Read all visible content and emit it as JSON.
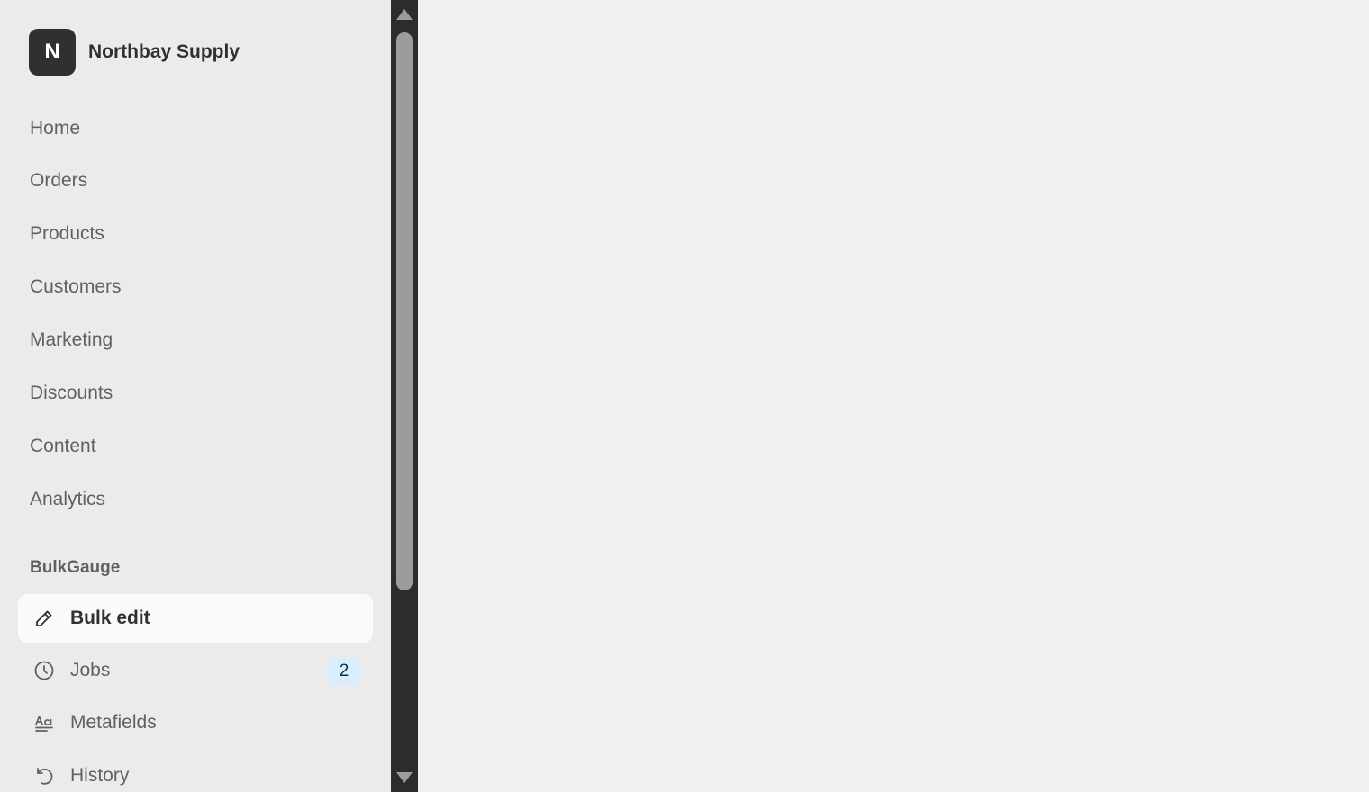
{
  "brand": {
    "initial": "N",
    "name": "Northbay Supply"
  },
  "nav": {
    "items": [
      {
        "label": "Home"
      },
      {
        "label": "Orders"
      },
      {
        "label": "Products"
      },
      {
        "label": "Customers"
      },
      {
        "label": "Marketing"
      },
      {
        "label": "Discounts"
      },
      {
        "label": "Content"
      },
      {
        "label": "Analytics"
      }
    ]
  },
  "app_section": {
    "title": "BulkGauge",
    "items": [
      {
        "label": "Bulk edit",
        "icon": "pencil-icon",
        "active": true
      },
      {
        "label": "Jobs",
        "icon": "clock-icon",
        "badge": "2"
      },
      {
        "label": "Metafields",
        "icon": "metafields-icon"
      },
      {
        "label": "History",
        "icon": "undo-icon"
      }
    ]
  },
  "colors": {
    "sidebar_bg": "#ebebeb",
    "active_bg": "#fafafa",
    "badge_bg": "#d9edfc",
    "scrollbar_bg": "#2c2c2c",
    "main_bg": "#f1f1f1"
  }
}
